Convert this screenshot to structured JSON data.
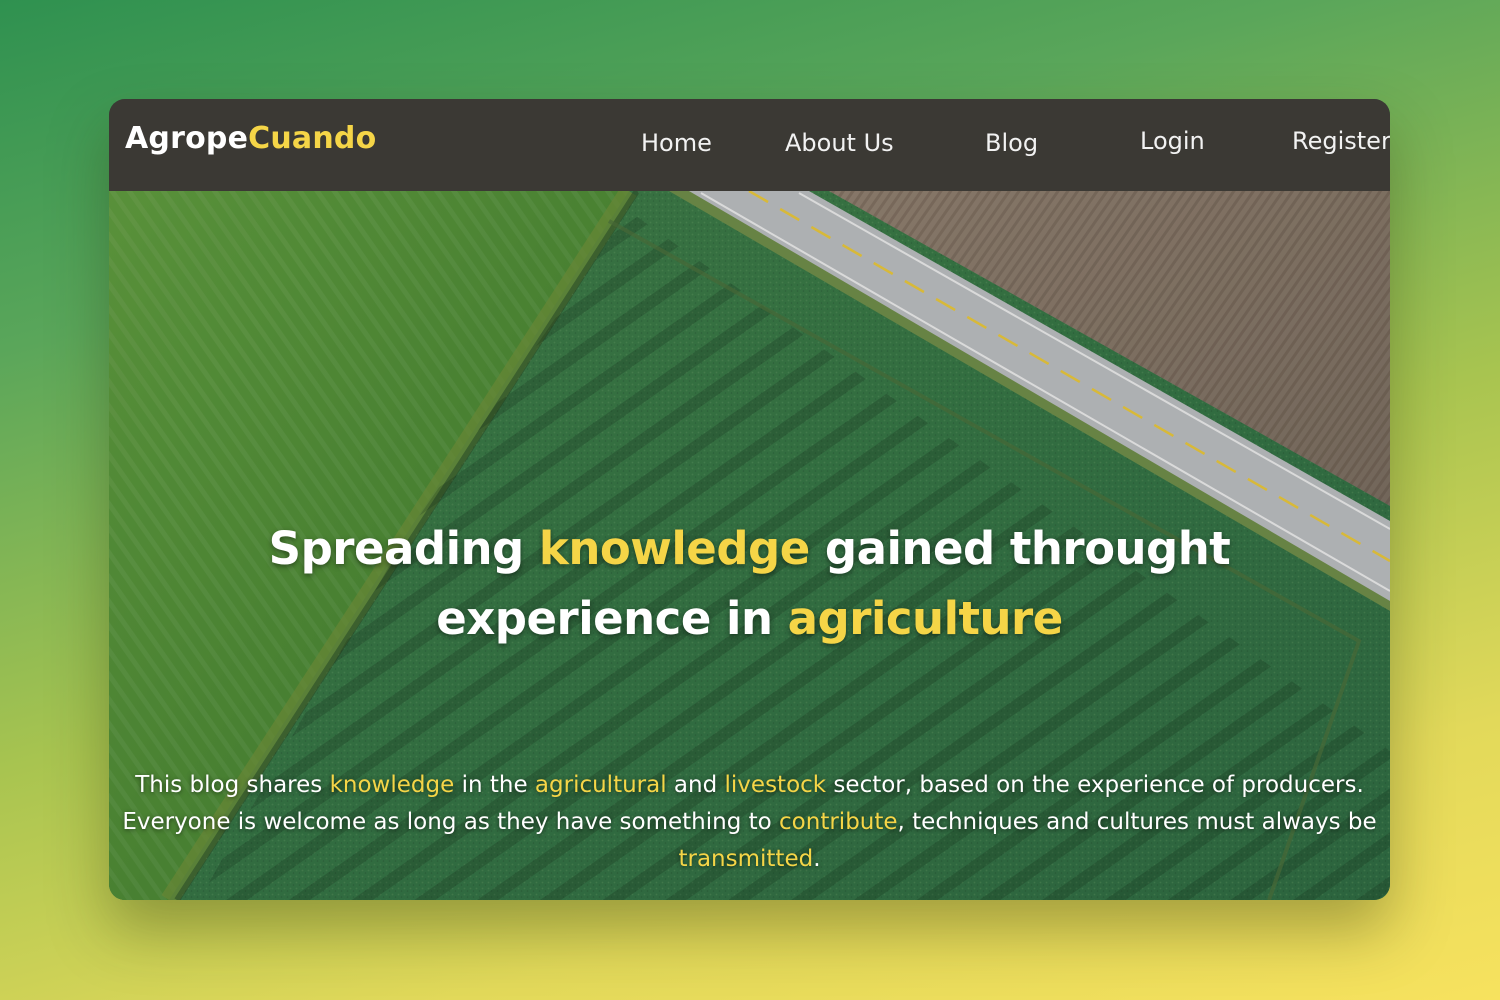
{
  "brand": {
    "name_part1": "Agrope",
    "name_part2": "Cuando",
    "accent_color": "#f5d547",
    "navbar_color": "#3b3934"
  },
  "nav": {
    "home": "Home",
    "about": "About Us",
    "blog": "Blog",
    "login": "Login",
    "register": "Register"
  },
  "hero": {
    "headline": {
      "p1": "Spreading ",
      "p2": "knowledge",
      "p3": " gained throught",
      "p4": "experience in ",
      "p5": "agriculture"
    },
    "description": {
      "s1": "This blog shares ",
      "s2": "knowledge",
      "s3": " in the ",
      "s4": "agricultural",
      "s5": " and ",
      "s6": "livestock",
      "s7": " sector, based on the experience of producers. Everyone is welcome as long as they have something to ",
      "s8": "contribute",
      "s9": ", techniques and cultures must always be ",
      "s10": "transmitted",
      "s11": "."
    },
    "background_image": "aerial-farm-fields-photo"
  }
}
